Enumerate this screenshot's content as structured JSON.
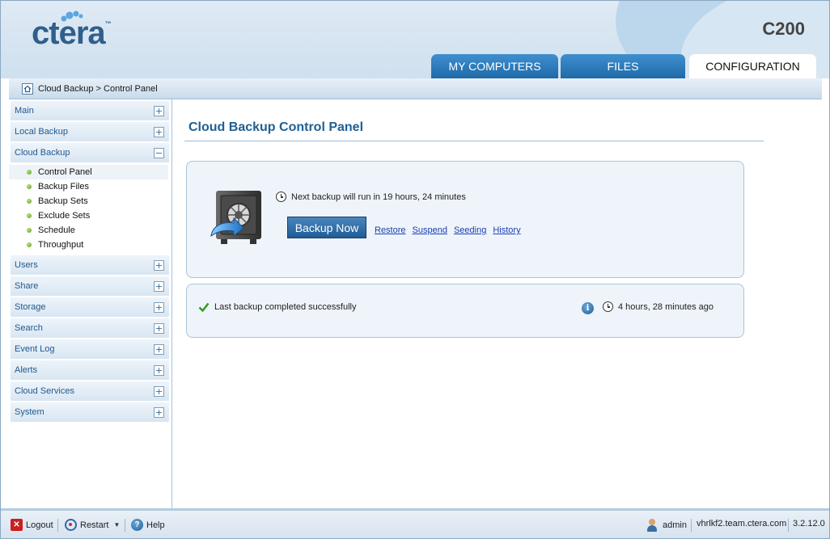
{
  "header": {
    "logo": "ctera",
    "logo_tm": "™",
    "model": "C200",
    "tabs": [
      {
        "label": "MY COMPUTERS",
        "active": false
      },
      {
        "label": "FILES",
        "active": false
      },
      {
        "label": "CONFIGURATION",
        "active": true
      }
    ]
  },
  "breadcrumb": {
    "icon": "home-icon",
    "text": "Cloud Backup > Control Panel"
  },
  "sidebar": {
    "sections": [
      {
        "label": "Main",
        "expanded": false
      },
      {
        "label": "Local Backup",
        "expanded": false
      },
      {
        "label": "Cloud Backup",
        "expanded": true,
        "items": [
          "Control Panel",
          "Backup Files",
          "Backup Sets",
          "Exclude Sets",
          "Schedule",
          "Throughput"
        ],
        "current": "Control Panel"
      },
      {
        "label": "Users",
        "expanded": false
      },
      {
        "label": "Share",
        "expanded": false
      },
      {
        "label": "Storage",
        "expanded": false
      },
      {
        "label": "Search",
        "expanded": false
      },
      {
        "label": "Event Log",
        "expanded": false
      },
      {
        "label": "Alerts",
        "expanded": false
      },
      {
        "label": "Cloud Services",
        "expanded": false
      },
      {
        "label": "System",
        "expanded": false
      }
    ],
    "plus": "+",
    "minus": "−"
  },
  "main": {
    "title": "Cloud Backup Control Panel",
    "next_backup": "Next backup will run in 19 hours, 24 minutes",
    "backup_now": "Backup Now",
    "links": [
      "Restore",
      "Suspend",
      "Seeding",
      "History"
    ],
    "last_backup": "Last backup completed successfully",
    "info_glyph": "i",
    "last_backup_ago": "4 hours, 28 minutes ago"
  },
  "footer": {
    "logout": "Logout",
    "restart": "Restart",
    "help": "Help",
    "user": "admin",
    "host": "vhrlkf2.team.ctera.com",
    "version": "3.2.12.0"
  },
  "colors": {
    "accent": "#1f5f94",
    "tab_blue": "#1f6aa8",
    "panel_bg": "#eef4fa",
    "success": "#2e9a1e"
  }
}
